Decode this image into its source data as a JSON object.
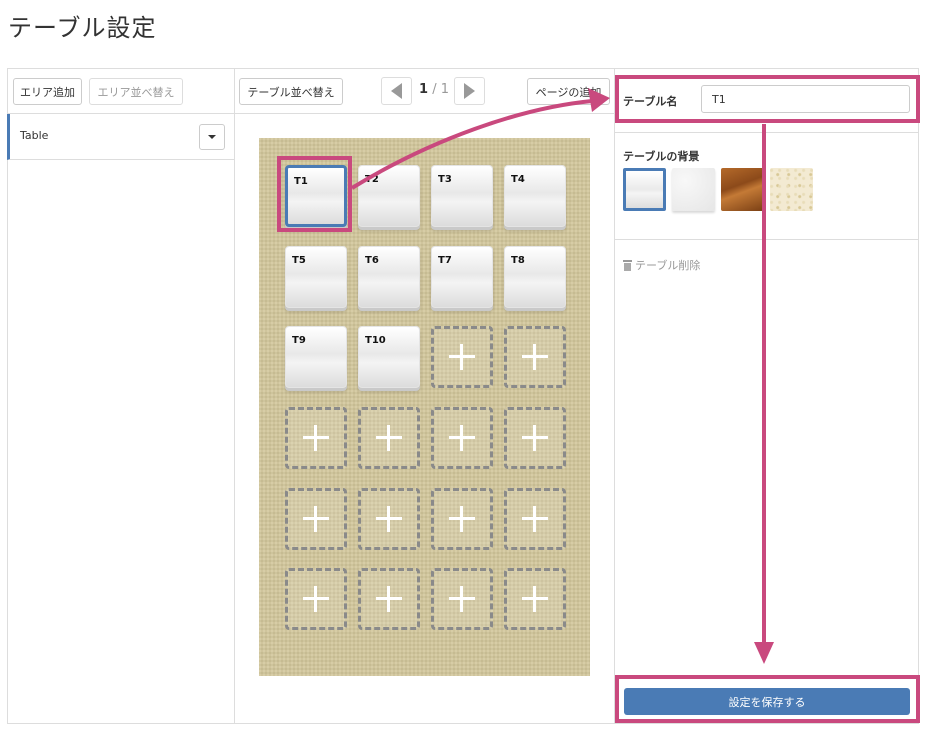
{
  "page": {
    "title": "テーブル設定"
  },
  "left_panel": {
    "add_area_label": "エリア追加",
    "sort_area_label": "エリア並べ替え",
    "areas": [
      {
        "label": "Table"
      }
    ]
  },
  "middle_panel": {
    "sort_tables_label": "テーブル並べ替え",
    "pager": {
      "current": "1",
      "separator": "/",
      "total": "1"
    },
    "add_page_label": "ページの追加",
    "tables": [
      {
        "name": "T1",
        "selected": true
      },
      {
        "name": "T2"
      },
      {
        "name": "T3"
      },
      {
        "name": "T4"
      },
      {
        "name": "T5"
      },
      {
        "name": "T6"
      },
      {
        "name": "T7"
      },
      {
        "name": "T8"
      },
      {
        "name": "T9"
      },
      {
        "name": "T10"
      }
    ],
    "empty_slots": 14
  },
  "right_panel": {
    "table_name_label": "テーブル名",
    "table_name_value": "T1",
    "background_label": "テーブルの背景",
    "backgrounds": [
      "white-gloss",
      "white-stone",
      "wood",
      "cream-speckle"
    ],
    "delete_label": "テーブル削除",
    "save_label": "設定を保存する"
  },
  "colors": {
    "accent": "#4a7bb5",
    "highlight": "#c9497e",
    "floor": "#d3c79c"
  }
}
